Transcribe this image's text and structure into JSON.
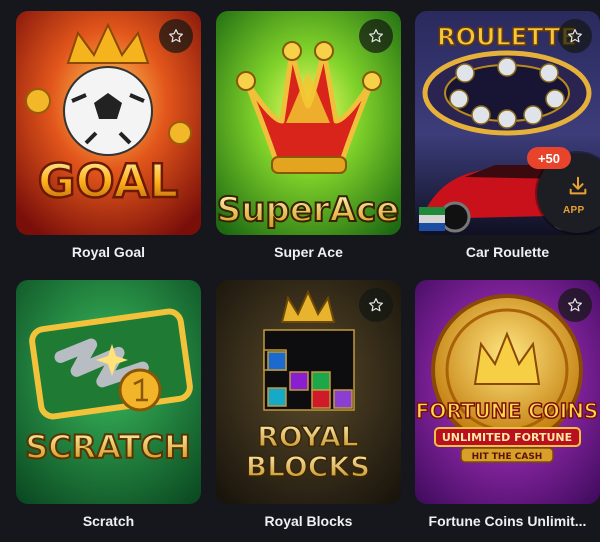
{
  "games": [
    {
      "name": "Royal Goal",
      "art_text": "GOAL"
    },
    {
      "name": "Super Ace",
      "art_text": "SuperAce"
    },
    {
      "name": "Car Roulette",
      "art_text": "ROULETTE"
    },
    {
      "name": "Scratch",
      "art_text": "SCRATCH"
    },
    {
      "name": "Royal Blocks",
      "art_text": [
        "ROYAL",
        "BLOCKS"
      ]
    },
    {
      "name": "Fortune Coins Unlimit...",
      "art_text": [
        "FORTUNE COINS",
        "UNLIMITED FORTUNE",
        "HIT THE CASH"
      ]
    }
  ],
  "app_button": {
    "label": "APP",
    "badge": "+50",
    "icon": "download-icon"
  },
  "favorite_icon": "star-outline-icon",
  "colors": {
    "background": "#15171c",
    "accent": "#e8a132",
    "badge": "#e8442b"
  }
}
